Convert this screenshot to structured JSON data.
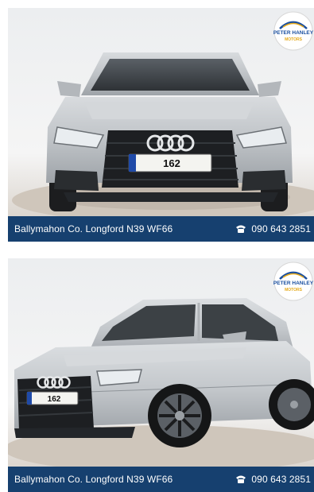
{
  "listings": [
    {
      "view": "front",
      "plate": "162",
      "address": "Ballymahon Co. Longford N39 WF66",
      "phone": "090 643 2851",
      "logo": {
        "line1": "PETER HANLEY",
        "line2": "MOTORS"
      }
    },
    {
      "view": "front-three-quarter",
      "plate": "162",
      "address": "Ballymahon Co. Longford N39 WF66",
      "phone": "090 643 2851",
      "logo": {
        "line1": "PETER HANLEY",
        "line2": "MOTORS"
      }
    }
  ],
  "icons": {
    "phone": "telephone-icon",
    "logo": "dealer-logo"
  },
  "colors": {
    "info_bar": "#16406f",
    "car_body": "#c4c8cc",
    "logo_blue": "#1a4fa0",
    "logo_gold": "#e6a919"
  }
}
